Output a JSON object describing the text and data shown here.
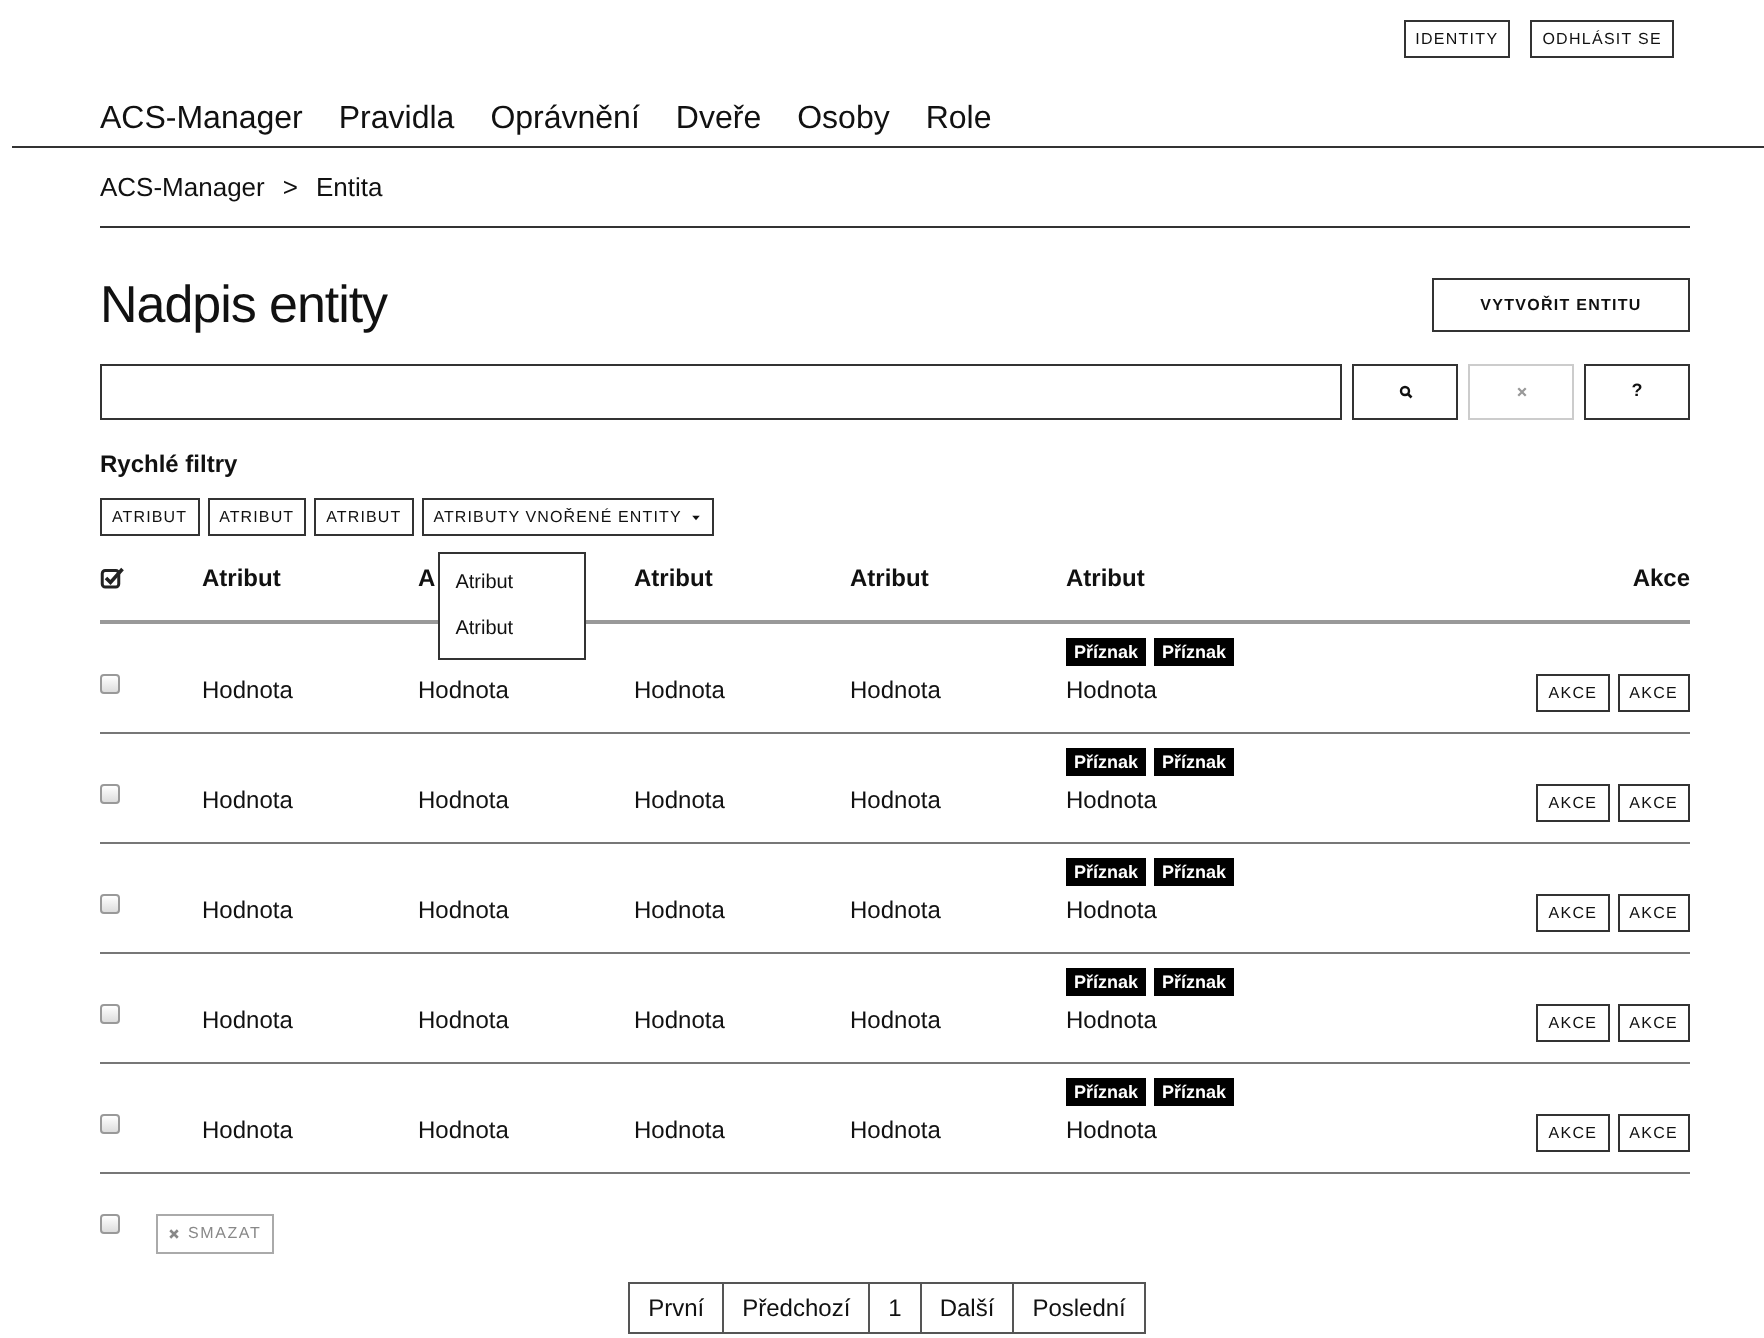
{
  "top_buttons": [
    {
      "label": "IDENTITY"
    },
    {
      "label": "ODHLÁSIT SE"
    }
  ],
  "nav": [
    "ACS-Manager",
    "Pravidla",
    "Oprávnění",
    "Dveře",
    "Osoby",
    "Role"
  ],
  "breadcrumb": [
    "ACS-Manager",
    ">",
    "Entita"
  ],
  "title": "Nadpis entity",
  "create_button": "VYTVOŘIT ENTITU",
  "search_buttons": [
    {
      "kind": "search",
      "disabled": false
    },
    {
      "kind": "clear",
      "disabled": true
    },
    {
      "kind": "help",
      "label": "?",
      "disabled": false
    }
  ],
  "quick_filters": {
    "title": "Rychlé filtry",
    "buttons": [
      {
        "label": "ATRIBUT",
        "dropdown": false
      },
      {
        "label": "ATRIBUT",
        "dropdown": false
      },
      {
        "label": "ATRIBUT",
        "dropdown": false
      },
      {
        "label": "ATRIBUTY VNOŘENÉ ENTITY",
        "dropdown": true,
        "expanded": true
      }
    ],
    "menu": [
      "Atribut",
      "Atribut"
    ]
  },
  "table": {
    "select_all": {
      "checked": true
    },
    "columns": [
      "Atribut",
      "A",
      "Atribut",
      "Atribut",
      "Atribut",
      "Akce"
    ],
    "rows": [
      {
        "checked": false,
        "cells": [
          "Hodnota",
          "Hodnota",
          "Hodnota",
          "Hodnota"
        ],
        "flags": [
          "Příznak",
          "Příznak"
        ],
        "value": "Hodnota",
        "actions": [
          "AKCE",
          "AKCE"
        ]
      },
      {
        "checked": false,
        "cells": [
          "Hodnota",
          "Hodnota",
          "Hodnota",
          "Hodnota"
        ],
        "flags": [
          "Příznak",
          "Příznak"
        ],
        "value": "Hodnota",
        "actions": [
          "AKCE",
          "AKCE"
        ]
      },
      {
        "checked": false,
        "cells": [
          "Hodnota",
          "Hodnota",
          "Hodnota",
          "Hodnota"
        ],
        "flags": [
          "Příznak",
          "Příznak"
        ],
        "value": "Hodnota",
        "actions": [
          "AKCE",
          "AKCE"
        ]
      },
      {
        "checked": false,
        "cells": [
          "Hodnota",
          "Hodnota",
          "Hodnota",
          "Hodnota"
        ],
        "flags": [
          "Příznak",
          "Příznak"
        ],
        "value": "Hodnota",
        "actions": [
          "AKCE",
          "AKCE"
        ]
      },
      {
        "checked": false,
        "cells": [
          "Hodnota",
          "Hodnota",
          "Hodnota",
          "Hodnota"
        ],
        "flags": [
          "Příznak",
          "Příznak"
        ],
        "value": "Hodnota",
        "actions": [
          "AKCE",
          "AKCE"
        ]
      }
    ]
  },
  "bulk": {
    "checked": false,
    "delete_button": {
      "label": "SMAZAT",
      "disabled": true
    }
  },
  "pagination": [
    "První",
    "Předchozí",
    "1",
    "Další",
    "Poslední"
  ]
}
